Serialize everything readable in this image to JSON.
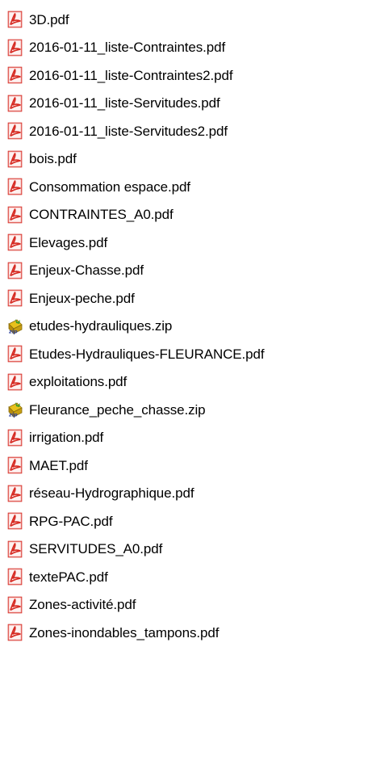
{
  "files": [
    {
      "name": "3D.pdf",
      "icon": "pdf-icon"
    },
    {
      "name": "2016-01-11_liste-Contraintes.pdf",
      "icon": "pdf-icon"
    },
    {
      "name": "2016-01-11_liste-Contraintes2.pdf",
      "icon": "pdf-icon"
    },
    {
      "name": "2016-01-11_liste-Servitudes.pdf",
      "icon": "pdf-icon"
    },
    {
      "name": "2016-01-11_liste-Servitudes2.pdf",
      "icon": "pdf-icon"
    },
    {
      "name": "bois.pdf",
      "icon": "pdf-icon"
    },
    {
      "name": "Consommation espace.pdf",
      "icon": "pdf-icon"
    },
    {
      "name": "CONTRAINTES_A0.pdf",
      "icon": "pdf-icon"
    },
    {
      "name": "Elevages.pdf",
      "icon": "pdf-icon"
    },
    {
      "name": "Enjeux-Chasse.pdf",
      "icon": "pdf-icon"
    },
    {
      "name": "Enjeux-peche.pdf",
      "icon": "pdf-icon"
    },
    {
      "name": "etudes-hydrauliques.zip",
      "icon": "zip-icon"
    },
    {
      "name": "Etudes-Hydrauliques-FLEURANCE.pdf",
      "icon": "pdf-icon"
    },
    {
      "name": "exploitations.pdf",
      "icon": "pdf-icon"
    },
    {
      "name": "Fleurance_peche_chasse.zip",
      "icon": "zip-icon"
    },
    {
      "name": "irrigation.pdf",
      "icon": "pdf-icon"
    },
    {
      "name": "MAET.pdf",
      "icon": "pdf-icon"
    },
    {
      "name": "réseau-Hydrographique.pdf",
      "icon": "pdf-icon"
    },
    {
      "name": "RPG-PAC.pdf",
      "icon": "pdf-icon"
    },
    {
      "name": "SERVITUDES_A0.pdf",
      "icon": "pdf-icon"
    },
    {
      "name": "textePAC.pdf",
      "icon": "pdf-icon"
    },
    {
      "name": "Zones-activité.pdf",
      "icon": "pdf-icon"
    },
    {
      "name": "Zones-inondables_tampons.pdf",
      "icon": "pdf-icon"
    }
  ],
  "colors": {
    "pdf_icon_red": "#d62a22",
    "zip_icon_green": "#3c9a2a",
    "zip_icon_yellow": "#e8c11c",
    "text": "#000000",
    "background": "#ffffff"
  }
}
